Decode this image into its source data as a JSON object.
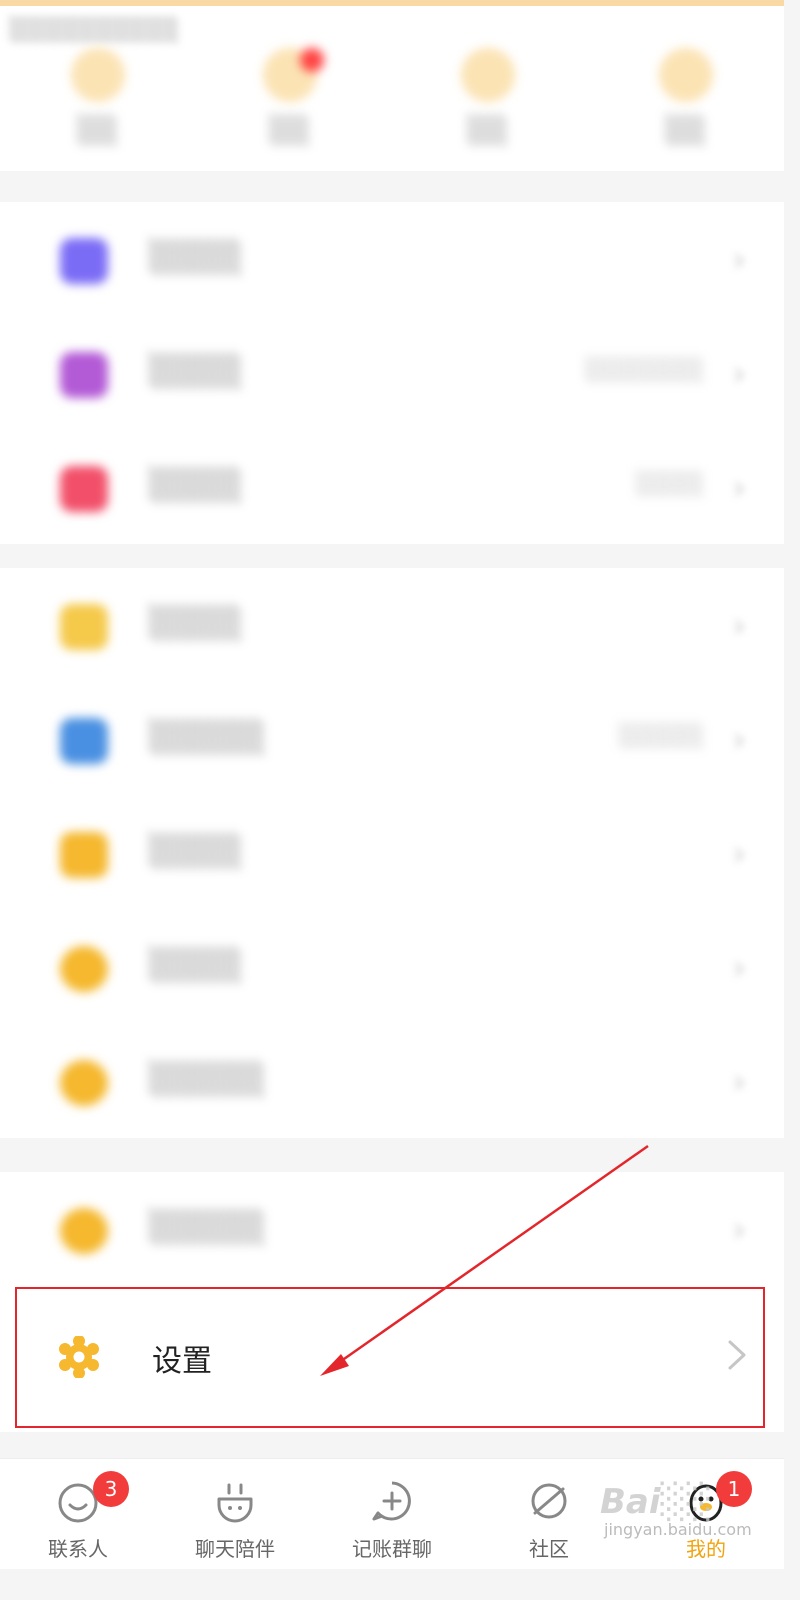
{
  "top": {
    "blurred_status": "░░░░░░░░░░",
    "quick_items": [
      {
        "label": "░░",
        "icon": "coin-icon"
      },
      {
        "label": "░░",
        "icon": "bell-icon"
      },
      {
        "label": "░░",
        "icon": "star-icon"
      },
      {
        "label": "░░",
        "icon": "clock-icon"
      }
    ]
  },
  "groups": [
    {
      "rows": [
        {
          "label": "░░░░",
          "extra": "",
          "icon": "gift-icon",
          "color": "#7b6cf6"
        },
        {
          "label": "░░░░",
          "extra": "░░░░░░░",
          "icon": "theme-icon",
          "color": "#b35ad6"
        },
        {
          "label": "░░░░",
          "extra": "░░░░",
          "icon": "calendar-icon",
          "color": "#f2506a"
        }
      ]
    },
    {
      "rows": [
        {
          "label": "░░░░",
          "extra": "",
          "icon": "moon-icon",
          "color": "#f5c94a"
        },
        {
          "label": "░░░░░",
          "extra": "░░░░░",
          "icon": "balloon-icon",
          "color": "#4a90e2"
        },
        {
          "label": "░░░░",
          "extra": "",
          "icon": "folder-icon",
          "color": "#f5b82e"
        },
        {
          "label": "░░░░",
          "extra": "",
          "icon": "star-icon",
          "color": "#f5b82e"
        },
        {
          "label": "░░░░░",
          "extra": "",
          "icon": "gear-small-icon",
          "color": "#f5b82e"
        }
      ]
    },
    {
      "rows": [
        {
          "label": "░░░░░",
          "extra": "",
          "icon": "share-icon",
          "color": "#f5b82e"
        }
      ]
    }
  ],
  "settings": {
    "label": "设置",
    "icon": "gear-icon",
    "color": "#f5b82e"
  },
  "bottom_nav": [
    {
      "label": "联系人",
      "icon": "smiley-icon",
      "badge": "3",
      "active": false
    },
    {
      "label": "聊天陪伴",
      "icon": "cup-icon",
      "badge": "",
      "active": false
    },
    {
      "label": "记账群聊",
      "icon": "add-circle-icon",
      "badge": "",
      "active": false
    },
    {
      "label": "社区",
      "icon": "planet-icon",
      "badge": "",
      "active": false
    },
    {
      "label": "我的",
      "icon": "penguin-icon",
      "badge": "1",
      "active": true
    }
  ],
  "watermark": {
    "logo": "Bai░░",
    "url": "jingyan.baidu.com"
  },
  "colors": {
    "accent": "#f0a410",
    "highlight": "#e3262b",
    "badge": "#f23c3c"
  }
}
